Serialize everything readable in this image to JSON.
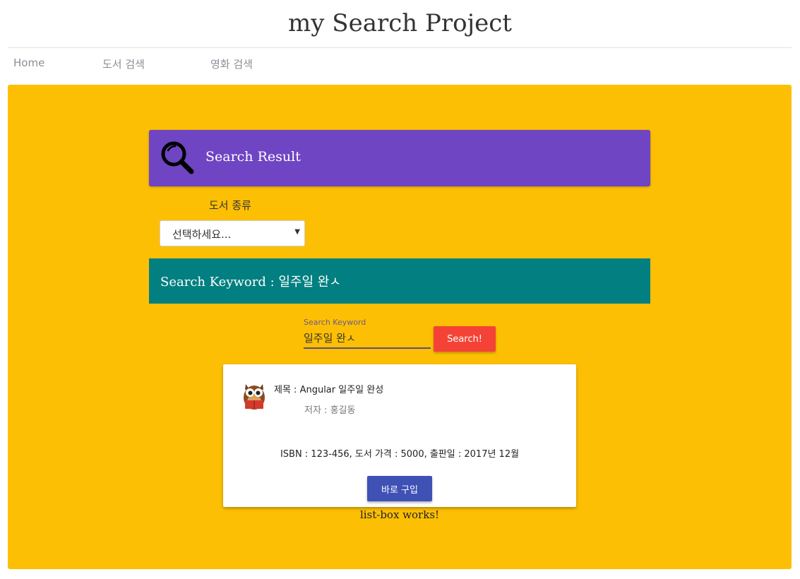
{
  "header": {
    "title": "my Search Project"
  },
  "nav": {
    "items": [
      "Home",
      "도서 검색",
      "영화 검색"
    ]
  },
  "result_header": {
    "title": "Search Result",
    "icon": "magnifier-icon"
  },
  "category": {
    "label": "도서 종류",
    "selected": "선택하세요..."
  },
  "keyword_header": {
    "prefix": "Search Keyword : ",
    "keyword": "일주일 완ㅅ"
  },
  "search": {
    "label": "Search Keyword",
    "value": "일주일 완ㅅ",
    "button": "Search!"
  },
  "book": {
    "avatar_icon": "owl-reading-icon",
    "title_line": "제목 : Angular 일주일 완성",
    "author_line": "저자 : 홍길동",
    "details": "ISBN : 123-456, 도서 가격 : 5000, 출판일 : 2017년 12월",
    "buy_label": "바로 구입"
  },
  "footer_note": "list-box works!",
  "colors": {
    "main_bg": "#fdbf04",
    "result_header": "#6f45c3",
    "keyword_header": "#027f80",
    "search_button": "#f44336",
    "buy_button": "#3f51b5"
  }
}
